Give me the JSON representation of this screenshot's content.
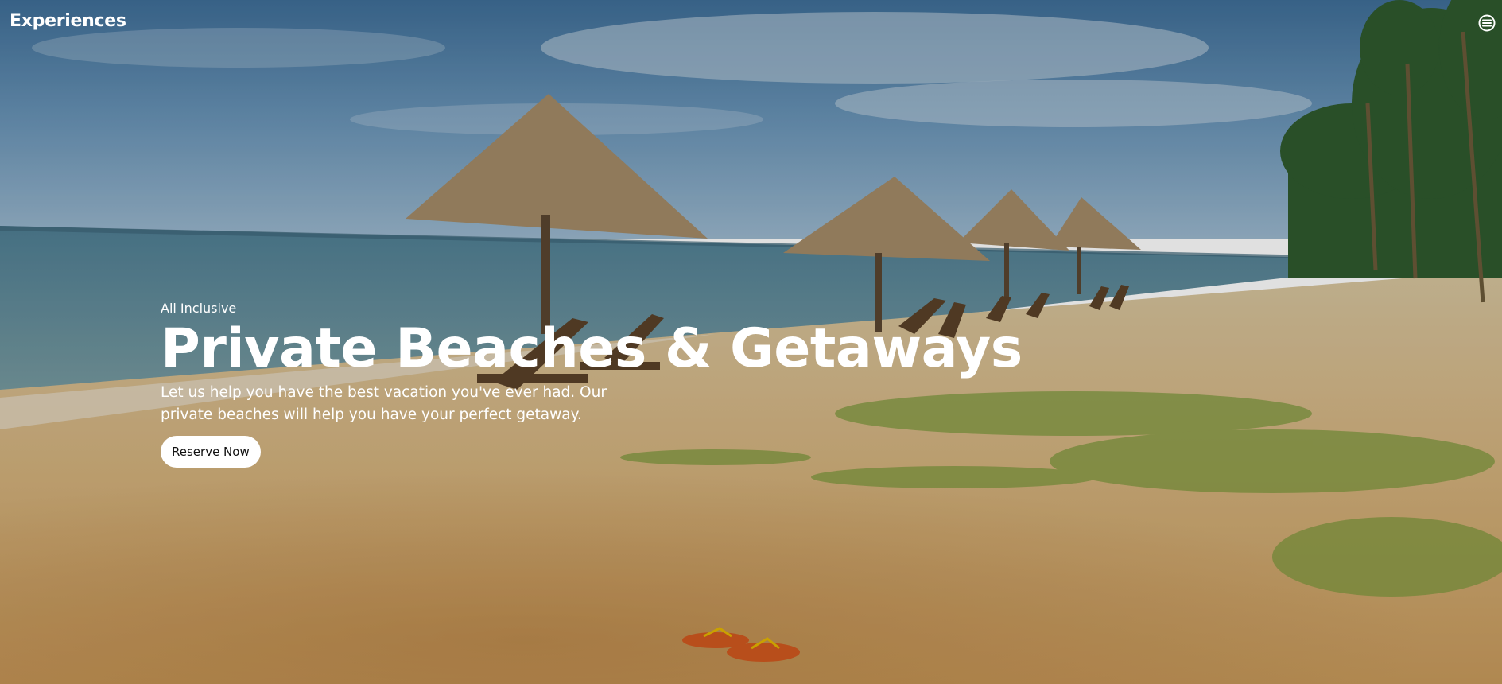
{
  "navbar": {
    "brand": "Experiences",
    "menu_icon": "menu-icon"
  },
  "hero": {
    "eyebrow": "All Inclusive",
    "title": "Private Beaches & Getaways",
    "description": "Let us help you have the best vacation you've ever had. Our private beaches will help you have your perfect getaway.",
    "cta_label": "Reserve Now"
  },
  "colors": {
    "text": "#ffffff",
    "button_bg": "#ffffff",
    "button_text": "#111111"
  }
}
